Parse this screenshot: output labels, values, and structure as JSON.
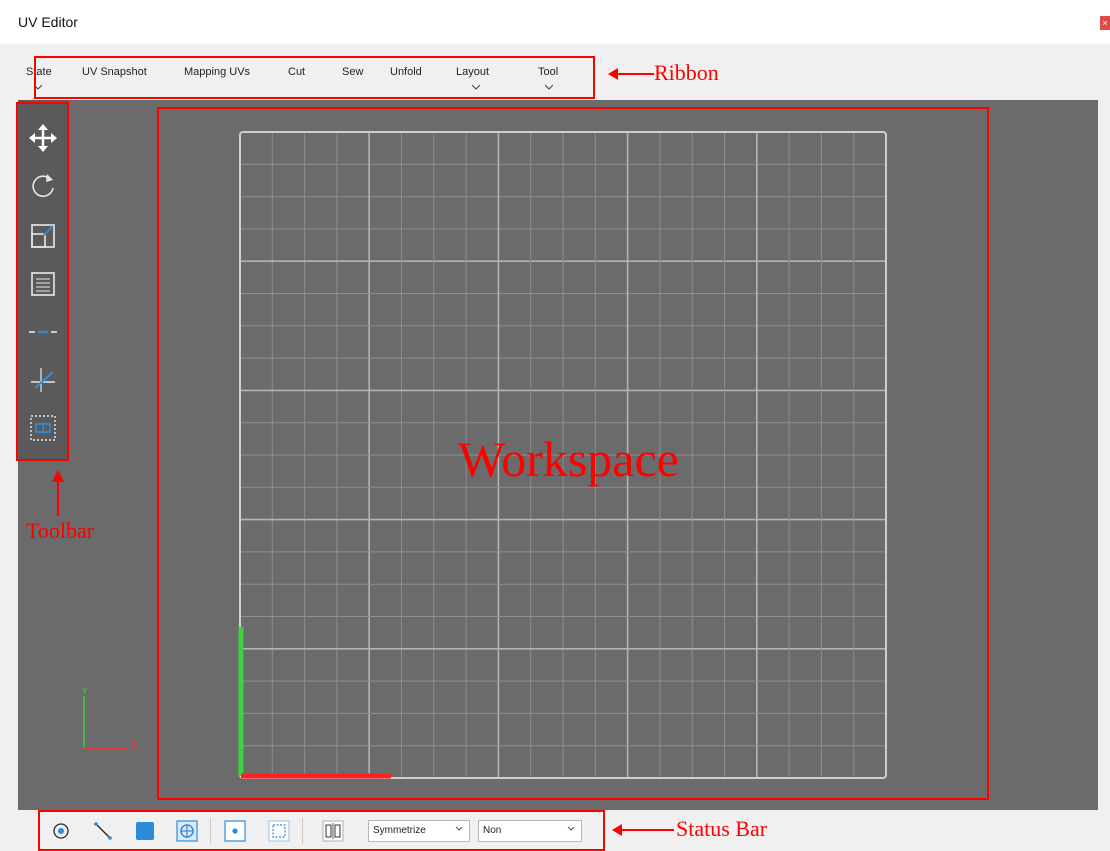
{
  "window": {
    "title": "UV Editor",
    "close_icon": "close-icon"
  },
  "ribbon": {
    "items": [
      {
        "label": "State",
        "has_dropdown": true
      },
      {
        "label": "UV Snapshot",
        "has_dropdown": false
      },
      {
        "label": "Mapping UVs",
        "has_dropdown": false
      },
      {
        "label": "Cut",
        "has_dropdown": false
      },
      {
        "label": "Sew",
        "has_dropdown": false
      },
      {
        "label": "Unfold",
        "has_dropdown": false
      },
      {
        "label": "Layout",
        "has_dropdown": true
      },
      {
        "label": "Tool",
        "has_dropdown": true
      }
    ]
  },
  "toolbar": {
    "tools": [
      "move-icon",
      "rotate-icon",
      "scale-icon",
      "align-icon",
      "distribute-icon",
      "straighten-icon",
      "select-region-icon"
    ]
  },
  "axis": {
    "x_label": "X",
    "y_label": "Y",
    "x_color": "#ff3030",
    "y_color": "#3cd23c"
  },
  "status_bar": {
    "mode_icons": [
      "vertex-mode-icon",
      "edge-mode-icon",
      "face-mode-icon",
      "element-mode-icon",
      "point-select-icon",
      "rect-select-icon",
      "symmetry-icon"
    ],
    "symmetrize_value": "Symmetrize",
    "symmetry_axis_value": "Non"
  },
  "annotations": {
    "ribbon_label": "Ribbon",
    "toolbar_label": "Toolbar",
    "workspace_label": "Workspace",
    "status_bar_label": "Status Bar",
    "color": "#ff0000"
  },
  "colors": {
    "viewport_bg": "#6b6b6b",
    "toolbar_bg": "#5a5a5a",
    "grid_line": "#8e8e8e",
    "grid_major": "#b4b4b4",
    "grid_border": "#cfcfcf",
    "accent_blue": "#2e8bd8"
  }
}
